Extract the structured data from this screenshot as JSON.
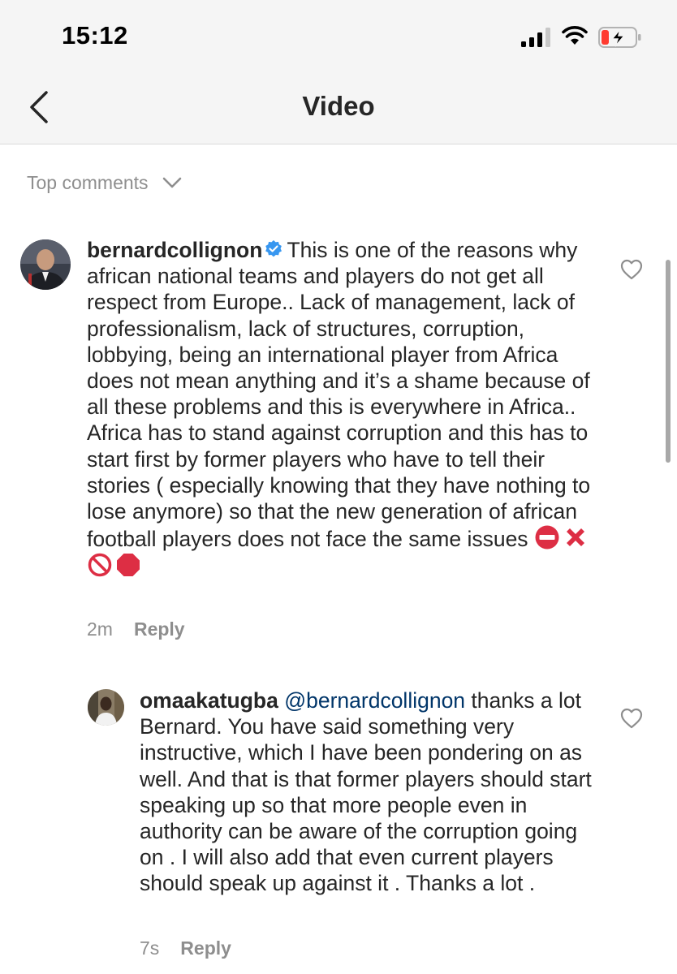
{
  "status_bar": {
    "time": "15:12"
  },
  "nav": {
    "title": "Video"
  },
  "comments_header": {
    "sort_label": "Top comments"
  },
  "comments": [
    {
      "username": "bernardcollignon",
      "verified": true,
      "text": "This is one of the reasons why african national teams and players do not get all respect from Europe.. Lack of management, lack of professionalism, lack of structures, corruption, lobbying, being an international player from Africa does not mean anything and it’s a shame because of all these problems and this is everywhere in Africa.. Africa has to stand against corruption and this has to start first by former players who have to tell their stories ( especially knowing that they have nothing to lose anymore) so that the new generation of african football players does not face the same issues",
      "emojis": [
        "no-entry",
        "cross-mark",
        "prohibited",
        "stop-sign"
      ],
      "time_ago": "2m",
      "reply_label": "Reply"
    },
    {
      "username": "omaakatugba",
      "mention": "@bernardcollignon",
      "text": "thanks a lot Bernard. You have said something very instructive, which I have been pondering on as well. And that is that former players should start speaking up so that more people even in authority can be aware of the corruption going on . I will also add that even current players should speak up against it . Thanks a lot .",
      "time_ago": "7s",
      "reply_label": "Reply"
    }
  ],
  "colors": {
    "text": "#262626",
    "secondary": "#8e8e8e",
    "mention": "#003569",
    "verified": "#3897f0",
    "battery_low": "#ff3b30"
  }
}
